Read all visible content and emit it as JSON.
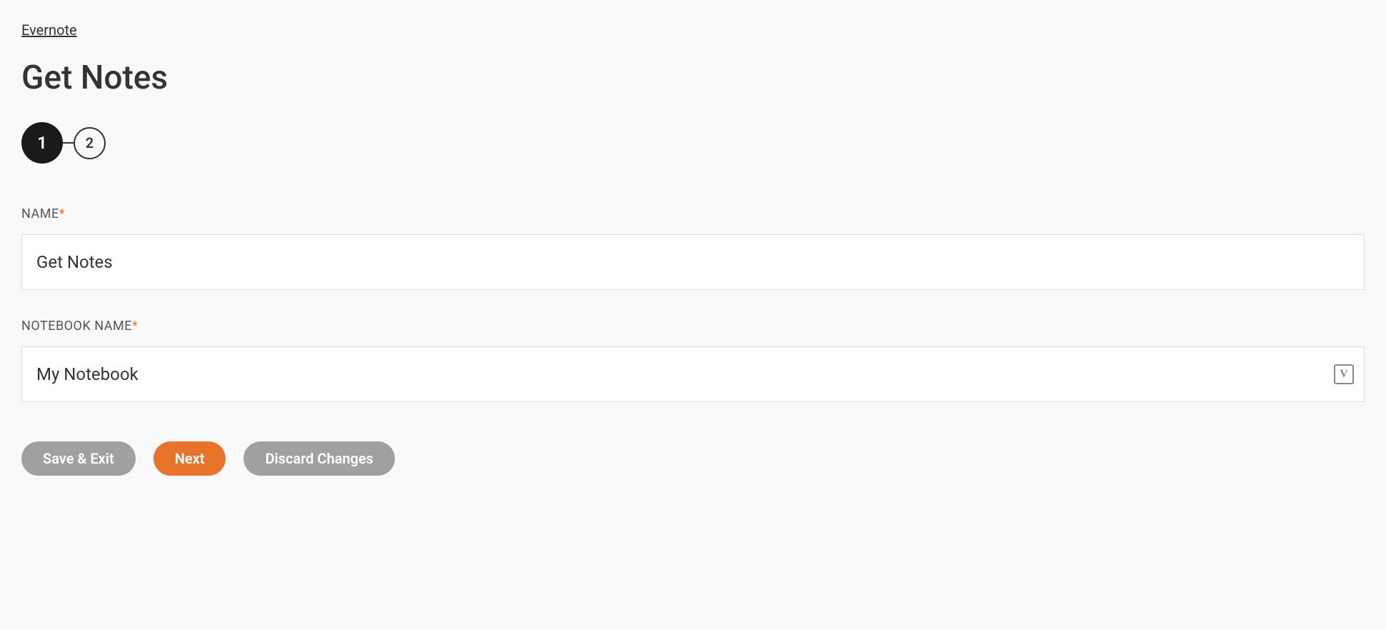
{
  "breadcrumb": {
    "label": "Evernote"
  },
  "page": {
    "title": "Get Notes"
  },
  "stepper": {
    "steps": [
      "1",
      "2"
    ]
  },
  "form": {
    "name_label": "NAME",
    "name_value": "Get Notes",
    "notebook_label": "NOTEBOOK NAME",
    "notebook_value": "My Notebook",
    "required_mark": "*",
    "variable_icon_text": "V"
  },
  "buttons": {
    "save_exit": "Save & Exit",
    "next": "Next",
    "discard": "Discard Changes"
  }
}
